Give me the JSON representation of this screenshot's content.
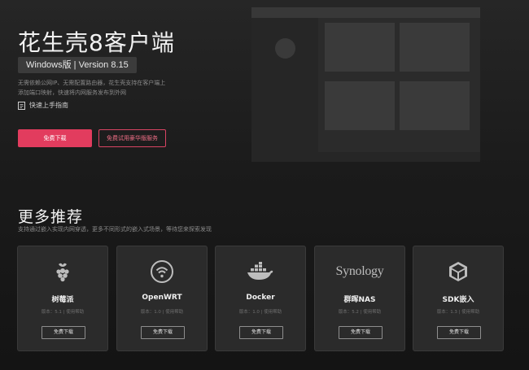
{
  "hero": {
    "title": "花生壳8客户端",
    "version": "Windows版 | Version 8.15",
    "desc_line1": "无需依赖公网IP、无需配置路由器，花生壳支持在客户端上",
    "desc_line2": "添加端口映射，快速将内网服务发布到外网",
    "guide_label": "快速上手指南",
    "download_label": "免费下载",
    "trial_label": "免费试用豪华版服务"
  },
  "more": {
    "title": "更多推荐",
    "subtitle": "支持通过嵌入实现内网穿透，更多不同形式的嵌入式场景，等待您来探索发现"
  },
  "cards": [
    {
      "name": "树莓派",
      "version": "版本：5.1",
      "sep": "|",
      "help": "使用帮助",
      "button": "免费下载",
      "icon": "raspberry-pi-icon"
    },
    {
      "name": "OpenWRT",
      "version": "版本：1.0",
      "sep": "|",
      "help": "使用帮助",
      "button": "免费下载",
      "icon": "openwrt-icon"
    },
    {
      "name": "Docker",
      "version": "版本：1.0",
      "sep": "|",
      "help": "使用帮助",
      "button": "免费下载",
      "icon": "docker-icon"
    },
    {
      "name": "群晖NAS",
      "version": "版本：5.2",
      "sep": "|",
      "help": "使用帮助",
      "button": "免费下载",
      "icon": "synology-logo",
      "logo_text": "Synology"
    },
    {
      "name": "SDK嵌入",
      "version": "版本：1.3",
      "sep": "|",
      "help": "使用帮助",
      "button": "免费下载",
      "icon": "cube-icon"
    }
  ],
  "colors": {
    "accent": "#e23c5e",
    "background": "#1b1b1b",
    "card": "#2b2b2b"
  }
}
